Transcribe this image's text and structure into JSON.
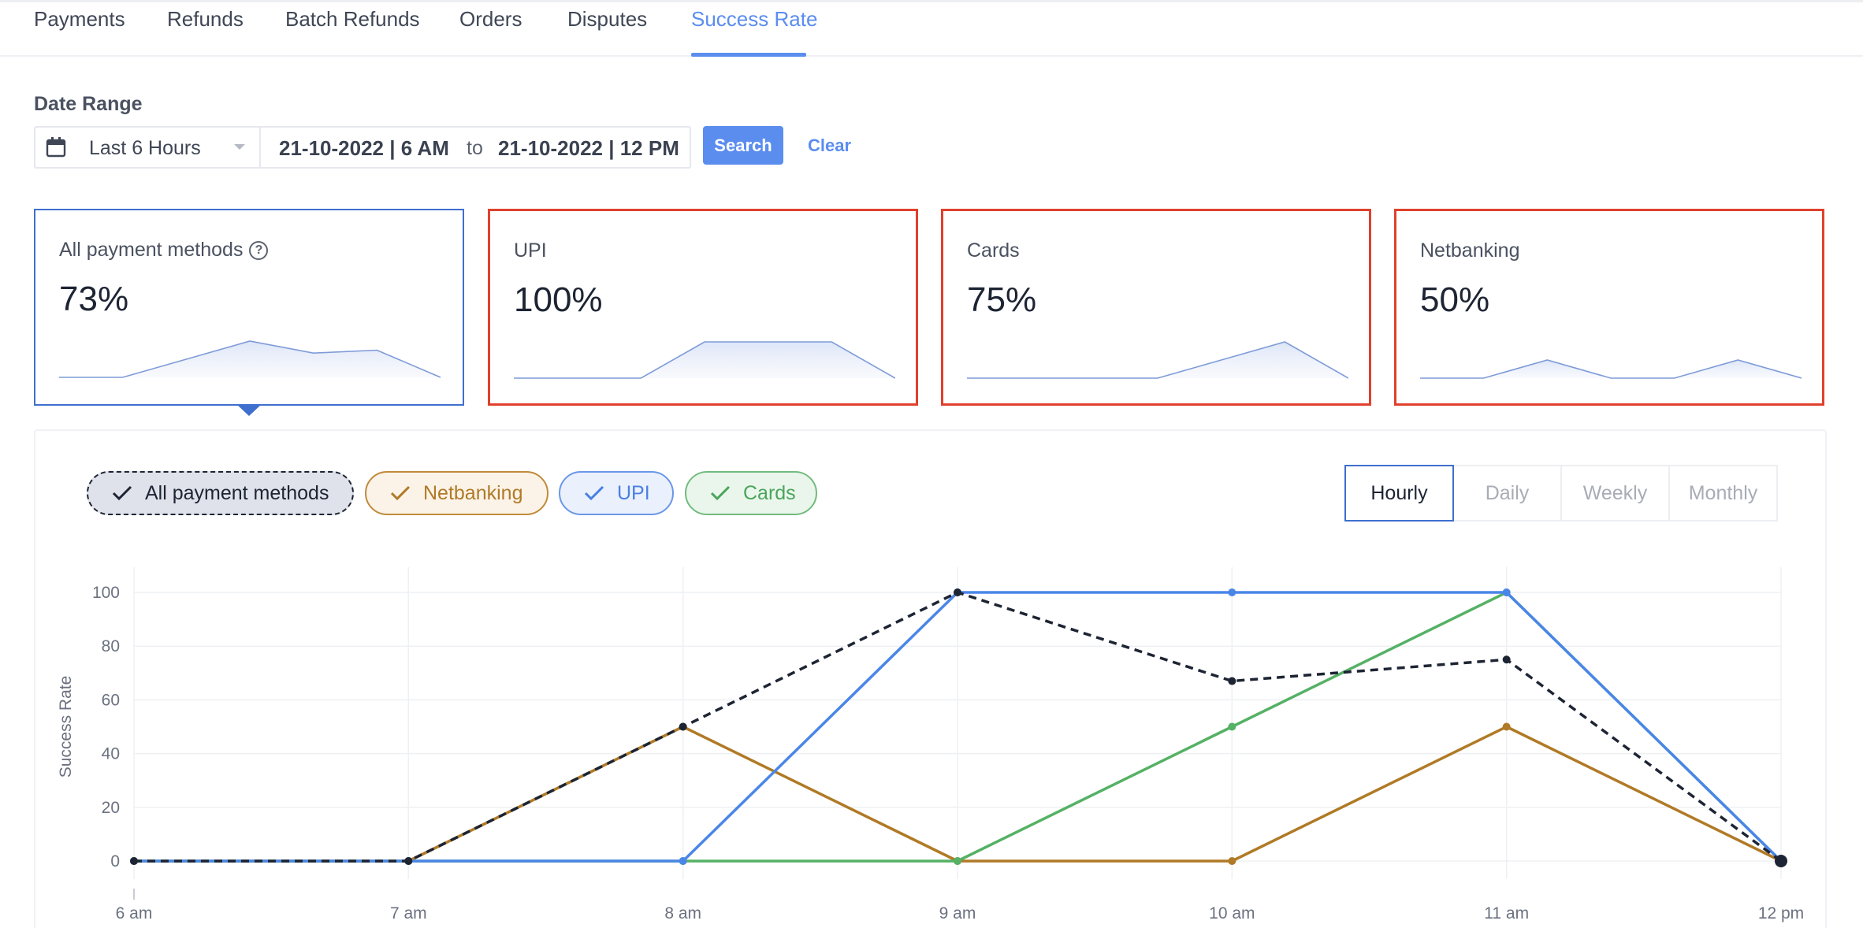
{
  "tabs": [
    {
      "label": "Payments"
    },
    {
      "label": "Refunds"
    },
    {
      "label": "Batch Refunds"
    },
    {
      "label": "Orders"
    },
    {
      "label": "Disputes"
    },
    {
      "label": "Success Rate",
      "active": true
    }
  ],
  "date_range": {
    "label": "Date Range",
    "preset": "Last 6 Hours",
    "from": "21-10-2022 | 6 AM",
    "to_word": "to",
    "to": "21-10-2022 | 12 PM",
    "search_label": "Search",
    "clear_label": "Clear"
  },
  "cards": [
    {
      "title": "All payment methods",
      "value": "73%",
      "selected": true,
      "help_glyph": "?"
    },
    {
      "title": "UPI",
      "value": "100%"
    },
    {
      "title": "Cards",
      "value": "75%"
    },
    {
      "title": "Netbanking",
      "value": "50%"
    }
  ],
  "filters": [
    {
      "label": "All payment methods",
      "checked": true
    },
    {
      "label": "Netbanking",
      "checked": true
    },
    {
      "label": "UPI",
      "checked": true
    },
    {
      "label": "Cards",
      "checked": true
    }
  ],
  "granularity": {
    "options": [
      "Hourly",
      "Daily",
      "Weekly",
      "Monthly"
    ],
    "selected": "Hourly"
  },
  "colors": {
    "accent": "#5b8def",
    "card_border_alert": "#e0402c",
    "card_border_selected": "#3f6fcf",
    "all": "#1d2433",
    "netbanking": "#b07a26",
    "upi": "#4a86e8",
    "cards": "#55b165"
  },
  "chart_data": {
    "type": "line",
    "categories": [
      "6 am",
      "7 am",
      "8 am",
      "9 am",
      "10 am",
      "11 am",
      "12 pm"
    ],
    "ylabel": "Success Rate",
    "xlabel": "",
    "ylim": [
      0,
      100
    ],
    "yticks": [
      0,
      20,
      40,
      60,
      80,
      100
    ],
    "grid": true,
    "series": [
      {
        "name": "All payment methods",
        "values": [
          0,
          0,
          50,
          100,
          67,
          75,
          0
        ],
        "style": "dashed"
      },
      {
        "name": "UPI",
        "values": [
          0,
          0,
          0,
          100,
          100,
          100,
          0
        ],
        "style": "solid"
      },
      {
        "name": "Cards",
        "values": [
          0,
          0,
          0,
          0,
          50,
          100,
          0
        ],
        "style": "solid"
      },
      {
        "name": "Netbanking",
        "values": [
          0,
          0,
          50,
          0,
          0,
          50,
          0
        ],
        "style": "solid"
      }
    ],
    "sparklines": {
      "All payment methods": [
        0,
        0,
        50,
        100,
        67,
        75,
        0
      ],
      "UPI": [
        0,
        0,
        0,
        100,
        100,
        100,
        0
      ],
      "Cards": [
        0,
        0,
        0,
        0,
        50,
        100,
        0
      ],
      "Netbanking": [
        0,
        0,
        50,
        0,
        0,
        50,
        0
      ]
    }
  }
}
